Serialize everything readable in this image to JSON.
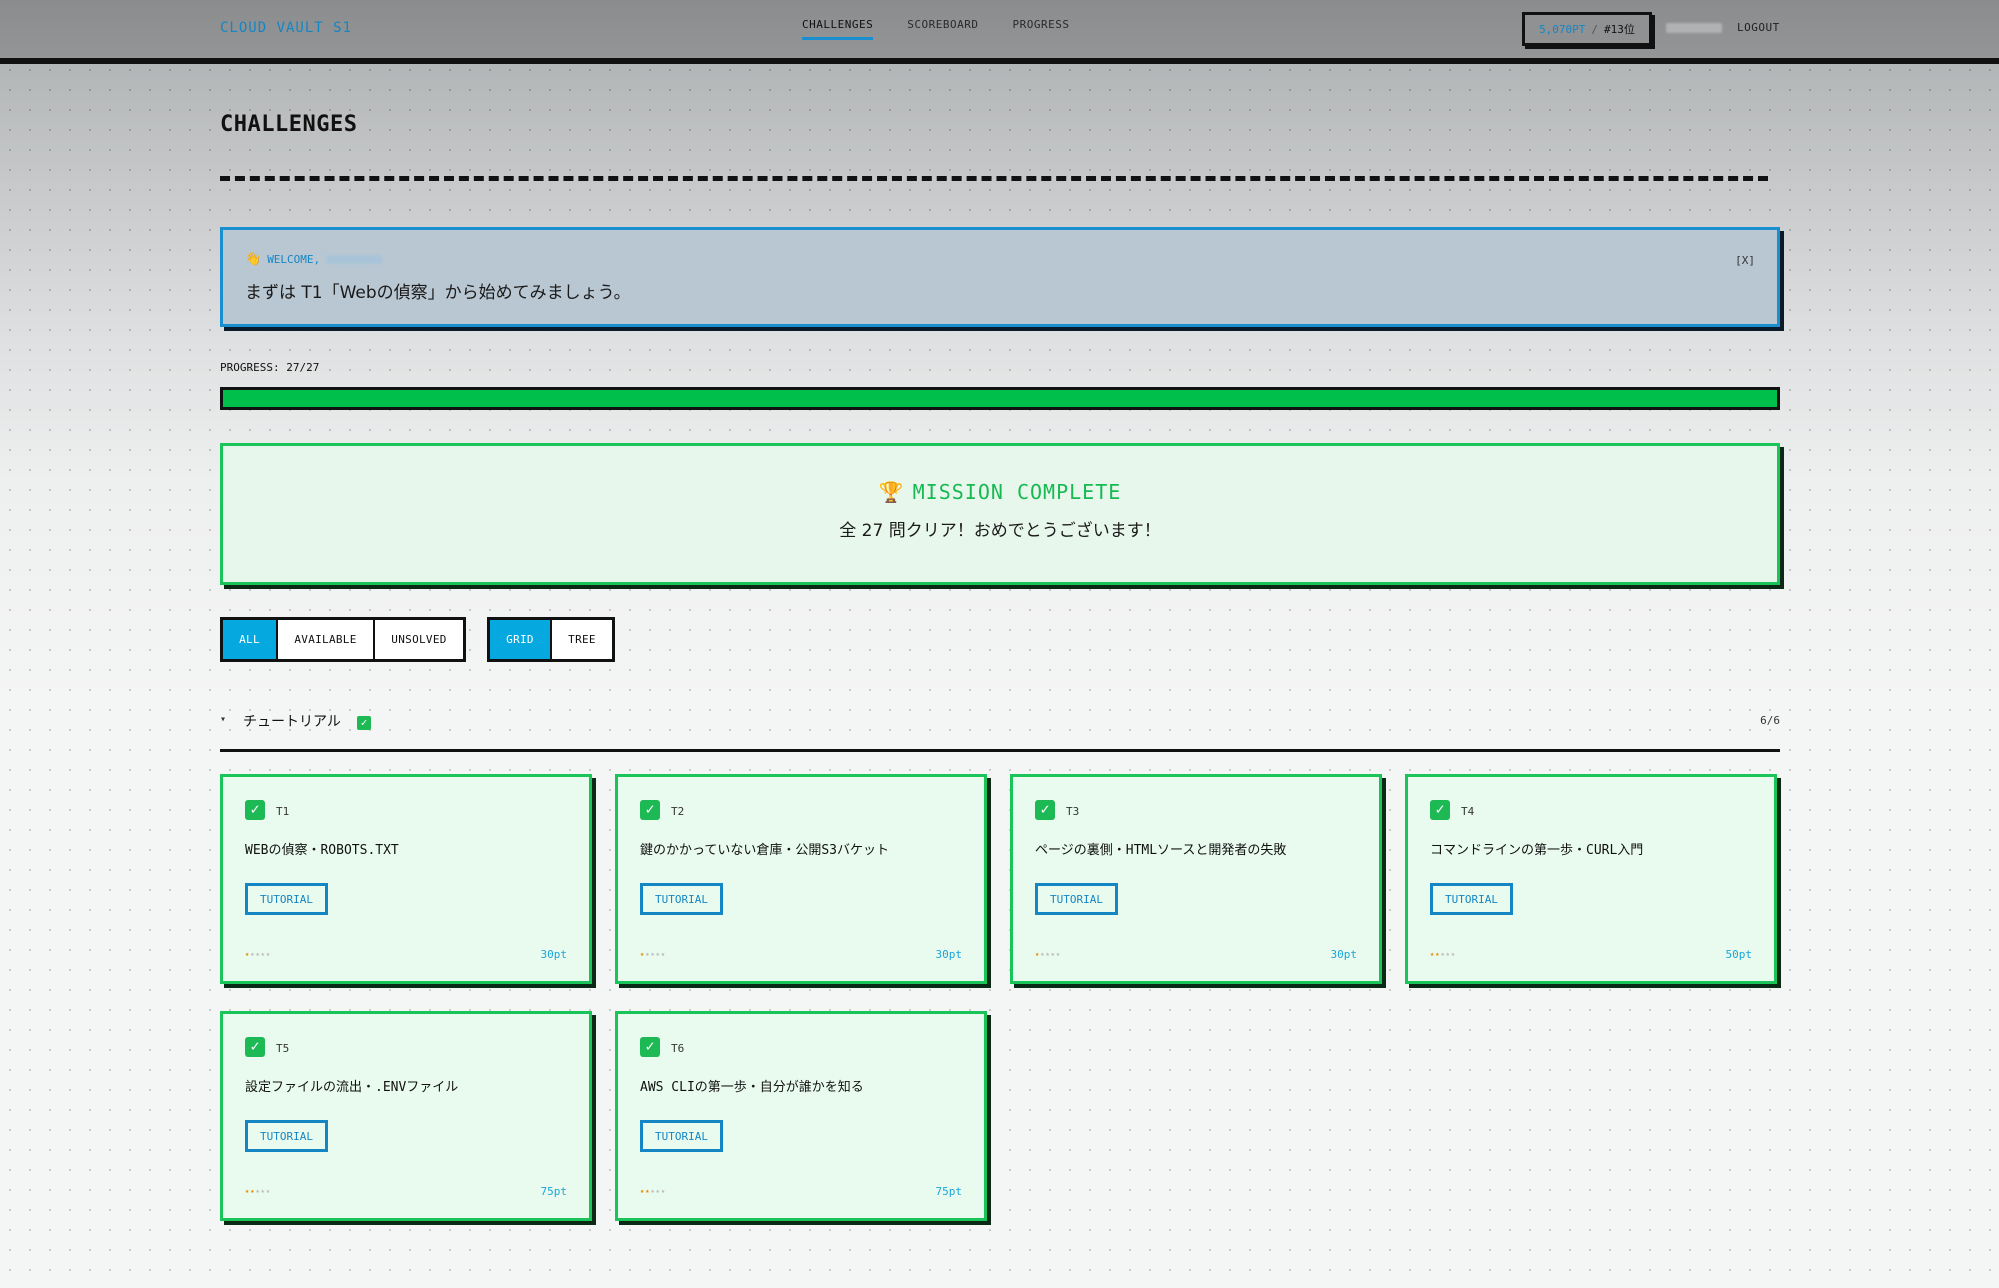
{
  "nav": {
    "brand": "CLOUD VAULT S1",
    "links": [
      "CHALLENGES",
      "SCOREBOARD",
      "PROGRESS"
    ],
    "active": "CHALLENGES",
    "score_points": "5,070PT",
    "score_sep": "/",
    "score_rank": "#13位",
    "logout": "LOGOUT"
  },
  "page": {
    "title": "CHALLENGES"
  },
  "welcome": {
    "prefix": "WELCOME,",
    "wave_icon": "waving-hand-icon",
    "message": "まずは T1「Webの偵察」から始めてみましょう。",
    "close": "[X]"
  },
  "progress": {
    "label": "PROGRESS: 27/27",
    "value": 1.0
  },
  "complete": {
    "trophy_icon": "trophy-icon",
    "title": "MISSION COMPLETE",
    "subtitle": "全 27 問クリア！おめでとうございます！"
  },
  "filters": {
    "status": [
      "ALL",
      "AVAILABLE",
      "UNSOLVED"
    ],
    "status_selected": "ALL",
    "view": [
      "GRID",
      "TREE"
    ],
    "view_selected": "GRID"
  },
  "category": {
    "name": "チュートリアル",
    "count": "6/6",
    "caret": "▾"
  },
  "cards": [
    {
      "id": "T1",
      "title": "WEBの偵察・ROBOTS.TXT",
      "tag": "TUTORIAL",
      "difficulty": 1,
      "points": "30pt"
    },
    {
      "id": "T2",
      "title": "鍵のかかっていない倉庫・公開S3バケット",
      "tag": "TUTORIAL",
      "difficulty": 1,
      "points": "30pt"
    },
    {
      "id": "T3",
      "title": "ページの裏側・HTMLソースと開発者の失敗",
      "tag": "TUTORIAL",
      "difficulty": 1,
      "points": "30pt"
    },
    {
      "id": "T4",
      "title": "コマンドラインの第一歩・CURL入門",
      "tag": "TUTORIAL",
      "difficulty": 2,
      "points": "50pt"
    },
    {
      "id": "T5",
      "title": "設定ファイルの流出・.ENVファイル",
      "tag": "TUTORIAL",
      "difficulty": 2,
      "points": "75pt"
    },
    {
      "id": "T6",
      "title": "AWS CLIの第一歩・自分が誰かを知る",
      "tag": "TUTORIAL",
      "difficulty": 2,
      "points": "75pt"
    }
  ],
  "colors": {
    "accent": "#1a8fd0",
    "success": "#19c459",
    "progress_fill": "#00c04b",
    "filter_active": "#06a9df"
  }
}
